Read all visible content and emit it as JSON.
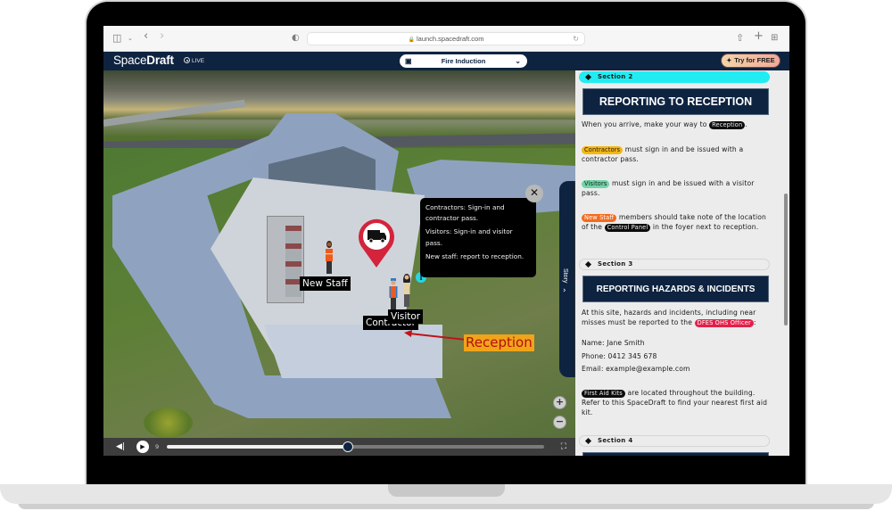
{
  "browser": {
    "url": "launch.spacedraft.com",
    "icons": [
      "sidebar-icon",
      "chevron-down-icon",
      "back-icon",
      "forward-icon",
      "shield-icon",
      "reload-icon",
      "share-icon",
      "new-tab-icon",
      "tab-overview-icon"
    ]
  },
  "header": {
    "logo_light": "Space",
    "logo_bold": "Draft",
    "live_label": "LIVE",
    "scene_selected": "Fire Induction",
    "try_free_label": "Try for FREE"
  },
  "viewer": {
    "labels": {
      "new_staff": "New Staff",
      "contractor": "Contractor",
      "visitor": "Visitor",
      "reception": "Reception"
    },
    "info_marker": "i",
    "poi_icon": "truck-icon",
    "tooltip": [
      "Contractors: Sign-in and contractor pass.",
      "Visitors: Sign-in and visitor pass.",
      "New staff: report to reception."
    ],
    "tooltip_close": "✕",
    "zoom_in": "+",
    "zoom_out": "−",
    "story_tab_label": "Story"
  },
  "timeline": {
    "step_count": "9",
    "progress_percent": 48
  },
  "story": {
    "sections": [
      {
        "label": "Section 2",
        "active": true,
        "title": "REPORTING TO RECEPTION",
        "paragraphs": {
          "p1_pre": "When you arrive, make your way to ",
          "p1_tag": "Reception",
          "p1_post": ".",
          "p2_tag": "Contractors",
          "p2_post": " must sign in and be issued with a contractor pass.",
          "p3_tag": "Visitors",
          "p3_post": " must sign in and be issued with a visitor pass.",
          "p4_tag": "New Staff",
          "p4_mid": " members should take note of the location of the ",
          "p4_tag2": "Control Panel",
          "p4_post": " in the foyer next to reception."
        }
      },
      {
        "label": "Section 3",
        "active": false,
        "title": "REPORTING HAZARDS & INCIDENTS",
        "paragraphs": {
          "p1_pre": "At this site, hazards and incidents, including near misses must be reported to the ",
          "p1_tag": "DFES OHS Officer",
          "p1_post": ":",
          "name": "Name: Jane Smith",
          "phone": "Phone: 0412 345 678",
          "email": "Email: example@example.com",
          "p2_tag": "First Aid Kits",
          "p2_post": " are located throughout the building. Refer to this SpaceDraft to find your nearest first aid kit."
        }
      },
      {
        "label": "Section 4",
        "active": false
      }
    ]
  },
  "colors": {
    "brand_navy": "#0d2340",
    "active_section": "#22ecf2",
    "tag_contractors": "#f4b614",
    "tag_visitors": "#6fd5a8",
    "tag_new_staff": "#f26b1f",
    "tag_officer": "#e3204a",
    "reception_label_bg": "#f0a41a",
    "reception_label_text": "#b4100e",
    "poi_pin": "#d3243c"
  }
}
